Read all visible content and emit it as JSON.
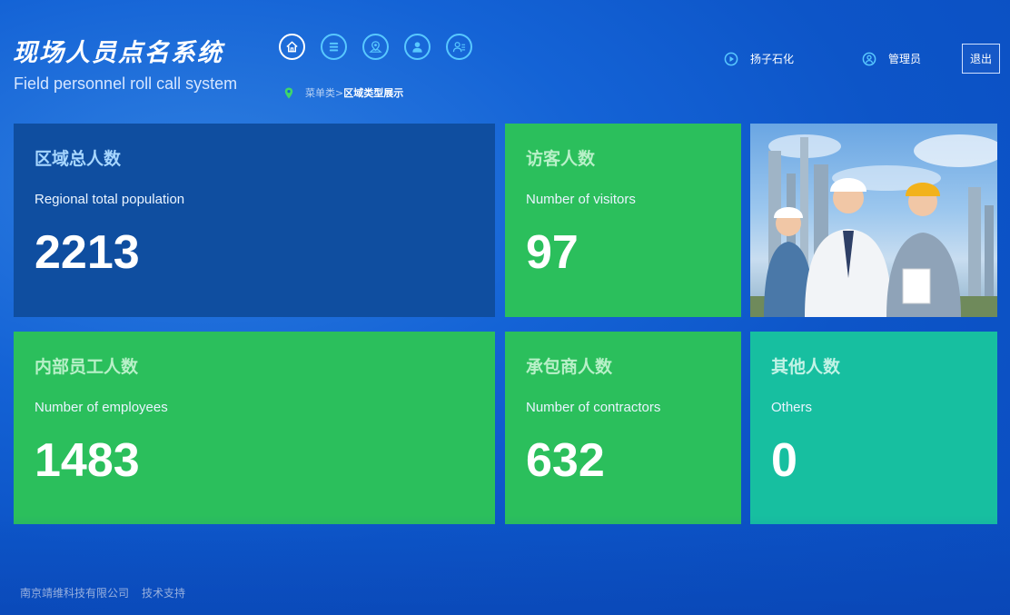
{
  "header": {
    "title_cn": "现场人员点名系统",
    "title_en": "Field personnel roll call system"
  },
  "nav": {
    "items": [
      {
        "icon": "home-icon"
      },
      {
        "icon": "menu-list-icon"
      },
      {
        "icon": "map-location-icon"
      },
      {
        "icon": "user-icon"
      },
      {
        "icon": "user-list-icon"
      }
    ]
  },
  "breadcrumb": {
    "parent": "菜单类>",
    "current": "区域类型展示"
  },
  "top_right": {
    "company": "扬子石化",
    "user": "管理员",
    "logout": "退出"
  },
  "cards": {
    "total": {
      "cn": "区域总人数",
      "en": "Regional total population",
      "value": "2213"
    },
    "visitors": {
      "cn": "访客人数",
      "en": "Number of visitors",
      "value": "97"
    },
    "employees": {
      "cn": "内部员工人数",
      "en": "Number of employees",
      "value": "1483"
    },
    "contractors": {
      "cn": "承包商人数",
      "en": "Number of contractors",
      "value": "632"
    },
    "others": {
      "cn": "其他人数",
      "en": "Others",
      "value": "0"
    }
  },
  "footer": {
    "company": "南京靖维科技有限公司",
    "support": "技术支持"
  },
  "colors": {
    "card_blue": "#0f4ea0",
    "card_green": "#2bbf5c",
    "card_teal": "#17bfa0",
    "nav_accent": "#58c8ff"
  }
}
